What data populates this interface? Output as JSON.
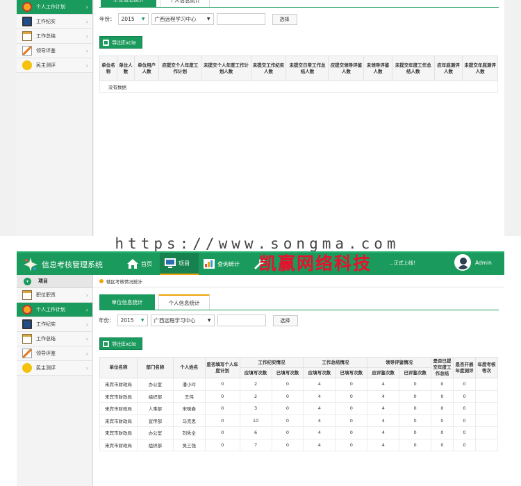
{
  "sidebar_top": [
    {
      "label": "个人工作计划",
      "icon": "clock-icon",
      "active": true
    },
    {
      "label": "工作纪实",
      "icon": "monitor-icon"
    },
    {
      "label": "工作总结",
      "icon": "notebook-icon"
    },
    {
      "label": "领导评鉴",
      "icon": "pencil-icon"
    },
    {
      "label": "民主测评",
      "icon": "smiley-icon"
    }
  ],
  "top": {
    "tab_unit": "单位信息统计",
    "tab_personal": "个人信息统计",
    "year_label": "年份：",
    "year_value": "2015",
    "org_value": "广西远程学习中心",
    "select_button": "选择",
    "export_button": "导出Excle",
    "columns": [
      "单位名称",
      "单位人数",
      "单位用户人数",
      "应提交个人年度工作计划",
      "未提交个人年度工作计划人数",
      "未提交工作纪实人数",
      "未提交日常工作总结人数",
      "应提交领导评鉴人数",
      "未领导评鉴人数",
      "未提交年度工作总结人数",
      "应年底测评人数",
      "未提交年底测评人数"
    ],
    "empty_text": "没有数据"
  },
  "watermark": "https://www.songma.com",
  "brand_overlay": "凯赢网络科技",
  "header": {
    "title": "信息考核管理系统",
    "nav": [
      {
        "label": "首页",
        "icon": "home-icon"
      },
      {
        "label": "项目",
        "icon": "monitor-icon",
        "active": true
      },
      {
        "label": "查询统计",
        "icon": "chart-icon"
      },
      {
        "label": "系统设置",
        "icon": "tools-icon"
      }
    ],
    "marquee": "...正式上线！",
    "user": "Admin"
  },
  "sidebar_bottom": {
    "header": "项目",
    "items": [
      {
        "label": "职位职责",
        "icon": "notebook-icon"
      },
      {
        "label": "个人工作计划",
        "icon": "clock-icon",
        "active": true
      },
      {
        "label": "工作纪实",
        "icon": "monitor-icon"
      },
      {
        "label": "工作总结",
        "icon": "notebook-icon"
      },
      {
        "label": "领导评鉴",
        "icon": "pencil-icon"
      },
      {
        "label": "民主测评",
        "icon": "smiley-icon"
      }
    ]
  },
  "bottom": {
    "breadcrumb": "辖区考核情况统计",
    "tab_unit": "单位信息统计",
    "tab_personal": "个人信息统计",
    "year_label": "年份：",
    "year_value": "2015",
    "org_value": "广西远程学习中心",
    "select_button": "选择",
    "export_button": "导出Excle",
    "headers": {
      "unit": "单位名称",
      "dept": "部门名称",
      "name": "个人姓名",
      "plan": "是否填写个人年度计划",
      "record_group": "工作纪实情况",
      "summary_group": "工作总结情况",
      "review_group": "领导评鉴情况",
      "annual_summary": "是否已提交年度工作总结",
      "year_end": "是否开展年度测评",
      "grade": "年度考核等次",
      "should": "应填写次数",
      "filled": "已填写次数",
      "review_should": "应评鉴次数",
      "review_done": "已评鉴次数"
    },
    "rows": [
      [
        "来宾市财政局",
        "办公室",
        "潘小玲",
        "0",
        "2",
        "0",
        "4",
        "0",
        "4",
        "0",
        "0",
        "0",
        ""
      ],
      [
        "来宾市财政局",
        "组织部",
        "王伟",
        "0",
        "2",
        "0",
        "4",
        "0",
        "4",
        "0",
        "0",
        "0",
        ""
      ],
      [
        "来宾市财政局",
        "人事部",
        "宋晓春",
        "0",
        "3",
        "0",
        "4",
        "0",
        "4",
        "0",
        "0",
        "0",
        ""
      ],
      [
        "来宾市财政局",
        "宣传部",
        "马克思",
        "0",
        "10",
        "0",
        "4",
        "0",
        "4",
        "0",
        "0",
        "0",
        ""
      ],
      [
        "来宾市财政局",
        "办公室",
        "刘秀全",
        "0",
        "6",
        "0",
        "4",
        "0",
        "4",
        "0",
        "0",
        "0",
        ""
      ],
      [
        "来宾市财政局",
        "组织部",
        "吴三强",
        "0",
        "7",
        "0",
        "4",
        "0",
        "4",
        "0",
        "0",
        "0",
        ""
      ]
    ]
  }
}
